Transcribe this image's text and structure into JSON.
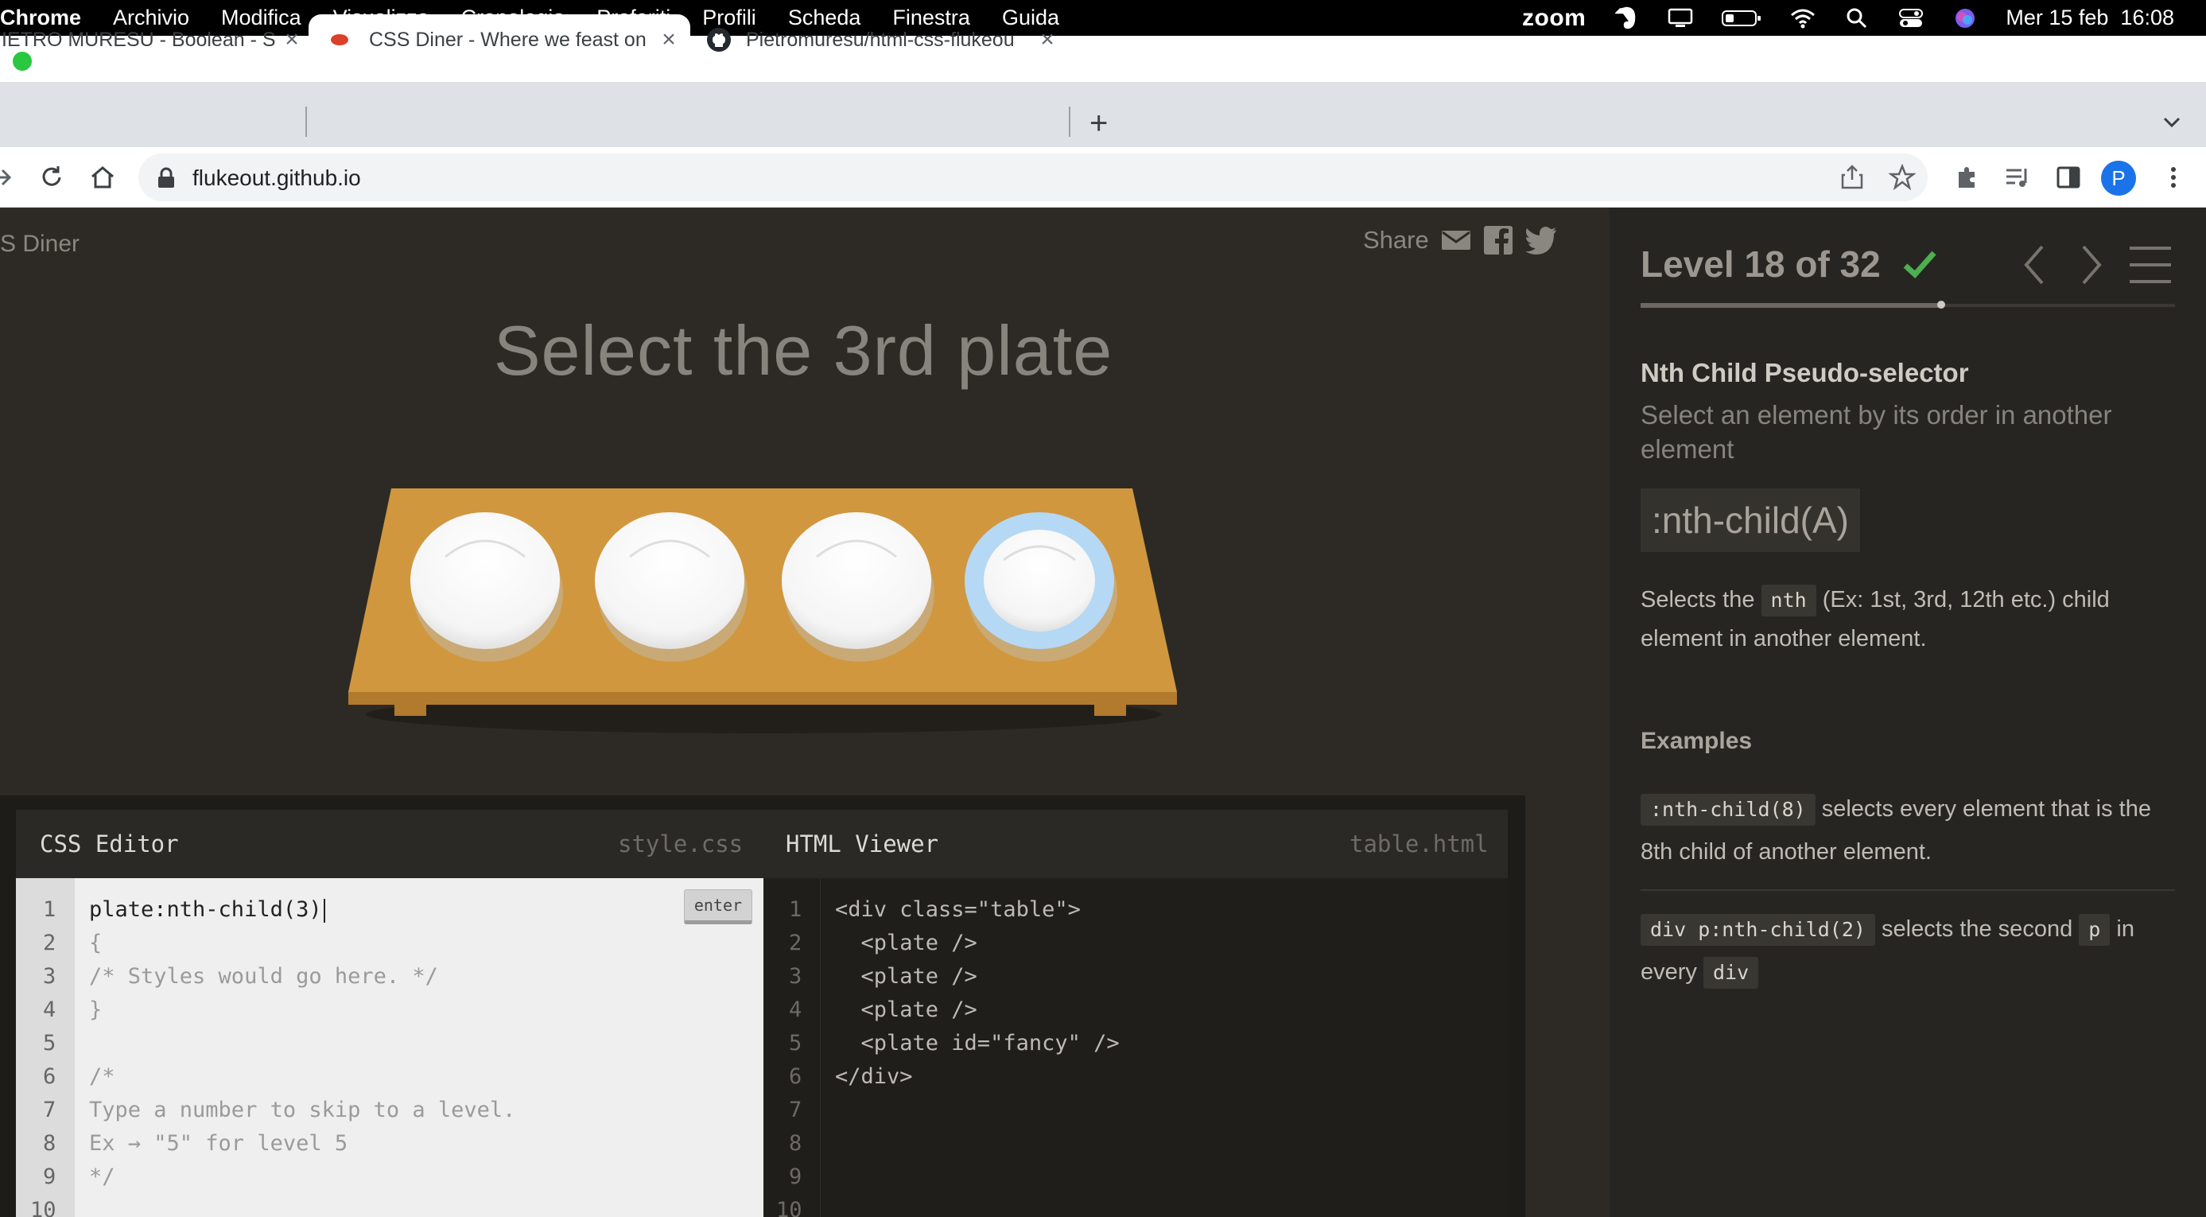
{
  "menubar": {
    "app_name": "Chrome",
    "items": [
      "Archivio",
      "Modifica",
      "Visualizza",
      "Cronologia",
      "Preferiti",
      "Profili",
      "Scheda",
      "Finestra",
      "Guida"
    ],
    "zoom_label": "zoom",
    "datetime": "Mer 15 feb  16:08"
  },
  "tabs": [
    {
      "title": "IETRO MURESU - Boolean - S",
      "close": "×",
      "active": false
    },
    {
      "title": "CSS Diner - Where we feast on",
      "close": "×",
      "active": true
    },
    {
      "title": "Pietromuresu/html-css-flukeou",
      "close": "×",
      "active": false
    }
  ],
  "toolbar": {
    "new_tab": "+",
    "url": "flukeout.github.io",
    "profile_initial": "P"
  },
  "page": {
    "brand": "S Diner",
    "share_label": "Share",
    "order": "Select the 3rd plate",
    "plates_count": 4,
    "highlighted_plate": 4
  },
  "css_editor": {
    "title": "CSS Editor",
    "file": "style.css",
    "enter_label": "enter",
    "line_numbers": [
      "1",
      "2",
      "3",
      "4",
      "5",
      "6",
      "7",
      "8",
      "9",
      "10"
    ],
    "input_value": "plate:nth-child(3)",
    "lines": [
      "{",
      "/* Styles would go here. */",
      "}",
      "",
      "/*",
      "Type a number to skip to a level.",
      "Ex → \"5\" for level 5",
      "*/",
      ""
    ]
  },
  "html_viewer": {
    "title": "HTML Viewer",
    "file": "table.html",
    "line_numbers": [
      "1",
      "2",
      "3",
      "4",
      "5",
      "6",
      "7",
      "8",
      "9",
      "10"
    ],
    "lines": [
      "<div class=\"table\">",
      "  <plate />",
      "  <plate />",
      "  <plate />",
      "  <plate id=\"fancy\" />",
      "</div>",
      "",
      "",
      "",
      ""
    ]
  },
  "sidebar": {
    "level_title": "Level 18 of 32",
    "level_completed": true,
    "level_progress": 0.5625,
    "selector_name": "Nth Child Pseudo-selector",
    "title": "Select an element by its order in another element",
    "syntax": ":nth-child(A)",
    "hint": {
      "pre": "Selects the",
      "tag": "nth",
      "post": "(Ex: 1st, 3rd, 12th etc.) child element in another element."
    },
    "examples_title": "Examples",
    "example1": {
      "tag": ":nth-child(8)",
      "text": "selects every element that is the 8th child of another element."
    },
    "example2": {
      "tag1": "div p:nth-child(2)",
      "text1": "selects the second",
      "tag2": "p",
      "text2": "in every",
      "tag3": "div"
    }
  },
  "colors": {
    "accent_check": "#4caf50",
    "plate_highlight": "#b5d8f4",
    "table": "#d0973f"
  }
}
